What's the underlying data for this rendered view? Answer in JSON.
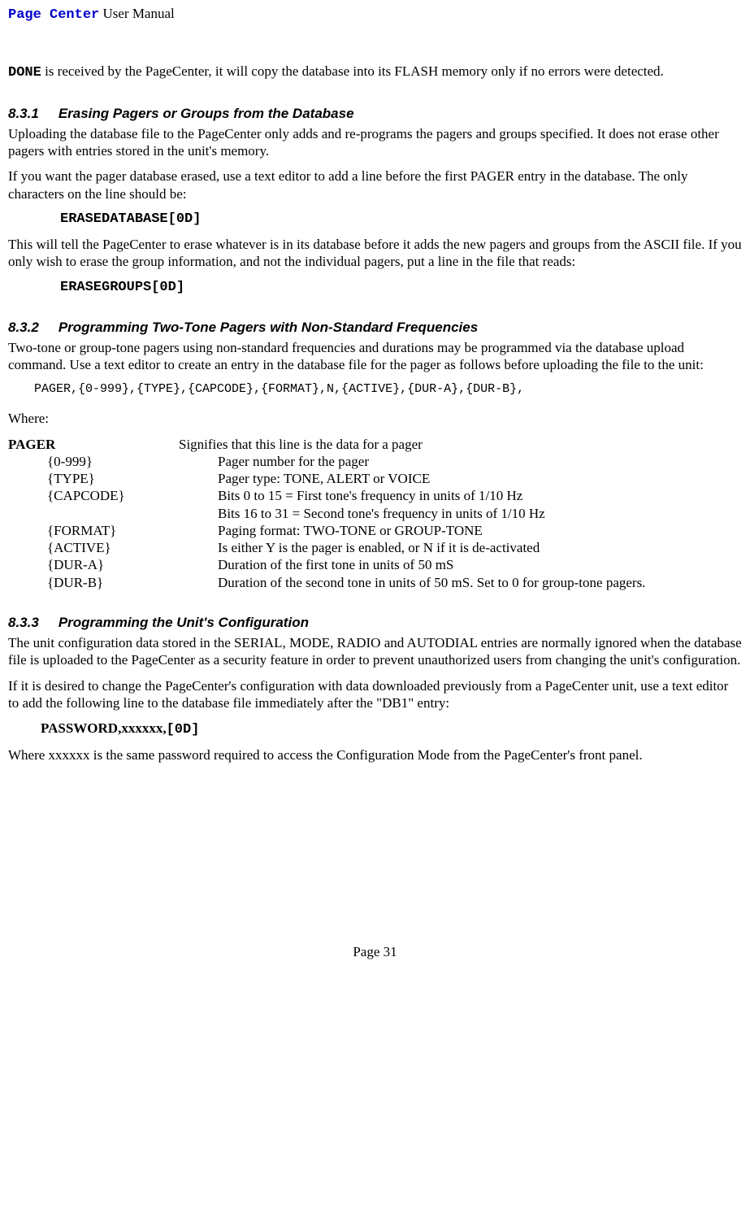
{
  "header": {
    "link": "Page Center",
    "rest": " User Manual"
  },
  "intro": {
    "done": "DONE",
    "rest": " is received by the PageCenter, it will copy the database into its FLASH memory only if no errors were detected."
  },
  "s831": {
    "num": "8.3.1",
    "title": "Erasing Pagers or Groups from the Database",
    "p1": "Uploading the database file to the PageCenter only adds and re-programs the pagers and groups specified.  It does not erase other pagers with entries stored in the unit's memory.",
    "p2": "If you want the pager database erased, use a text editor to add a line before the first PAGER entry in the database.  The only characters on the line should be:",
    "code1": "ERASEDATABASE[0D]",
    "p3": "This will tell the PageCenter to erase whatever is in its database before it adds the new pagers and groups from the ASCII file.  If you only wish to erase the group information, and not the individual pagers, put a line in the file that reads:",
    "code2": "ERASEGROUPS[0D]"
  },
  "s832": {
    "num": "8.3.2",
    "title": "Programming Two-Tone Pagers with Non-Standard Frequencies",
    "p1": "Two-tone or group-tone pagers using non-standard frequencies and durations may be programmed via the database upload command.  Use a text editor to create an entry in the database file for the pager as follows before uploading the file to the unit:",
    "code": "PAGER,{0-999},{TYPE},{CAPCODE},{FORMAT},N,{ACTIVE},{DUR-A},{DUR-B},",
    "where": "Where:",
    "defs": [
      {
        "term": "PAGER",
        "bold": true,
        "indent": false,
        "desc": "Signifies that this line is the data for a pager"
      },
      {
        "term": "{0-999}",
        "bold": false,
        "indent": true,
        "desc": "Pager number for the pager"
      },
      {
        "term": "{TYPE}",
        "bold": false,
        "indent": true,
        "desc": "Pager type:  TONE, ALERT or VOICE"
      },
      {
        "term": "{CAPCODE}",
        "bold": false,
        "indent": true,
        "desc": "Bits 0 to 15 =  First tone's frequency in units of 1/10 Hz"
      },
      {
        "term": "",
        "bold": false,
        "indent": true,
        "desc": "Bits 16 to 31 = Second tone's frequency in units of 1/10 Hz"
      },
      {
        "term": "{FORMAT}",
        "bold": false,
        "indent": true,
        "desc": "Paging format:  TWO-TONE or GROUP-TONE"
      },
      {
        "term": "{ACTIVE}",
        "bold": false,
        "indent": true,
        "desc": "Is either Y is the pager is enabled, or N if it is de-activated"
      },
      {
        "term": "{DUR-A}",
        "bold": false,
        "indent": true,
        "desc": "Duration of the first tone in units of 50 mS"
      },
      {
        "term": "{DUR-B}",
        "bold": false,
        "indent": true,
        "desc": "Duration of the second tone in units of 50 mS.  Set to 0 for group-tone pagers."
      }
    ]
  },
  "s833": {
    "num": "8.3.3",
    "title": "Programming the Unit's Configuration",
    "p1": "The unit configuration data stored in the SERIAL, MODE, RADIO and AUTODIAL entries are normally ignored when the database file is uploaded to the PageCenter as a security feature in order to prevent unauthorized users from changing the unit's configuration.",
    "p2": "If it is desired to change the PageCenter's configuration with data downloaded previously from a PageCenter unit, use a text editor to add the following line to the database file immediately after the \"DB1\" entry:",
    "pw_bold": "PASSWORD,xxxxxx,",
    "pw_mono": "[0D]",
    "p3": "Where xxxxxx is the same password required to access the Configuration Mode from the PageCenter's front panel."
  },
  "footer": "Page 31"
}
